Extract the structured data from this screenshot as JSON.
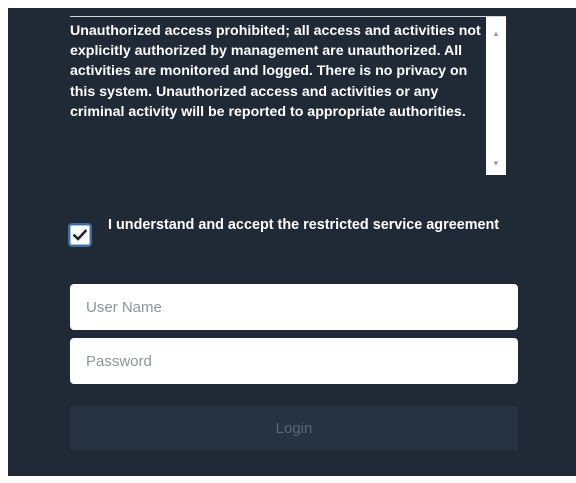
{
  "notice": {
    "text": "Unauthorized access prohibited; all access and activities not explicitly authorized by management are unauthorized. All activities are monitored and logged. There is no privacy on this system. Unauthorized access and activities or any criminal activity will be reported to appropriate authorities."
  },
  "agreement": {
    "checked": true,
    "label": "I understand and accept the restricted service agreement"
  },
  "form": {
    "username_placeholder": "User Name",
    "password_placeholder": "Password",
    "login_label": "Login"
  },
  "colors": {
    "background": "#1f2a36",
    "button_disabled": "#263340",
    "checkbox_ring": "#3d6e9c"
  },
  "icons": {
    "checkbox_mark": "checkmark-icon",
    "scroll_up": "scroll-up-arrow-icon",
    "scroll_down": "scroll-down-arrow-icon"
  }
}
